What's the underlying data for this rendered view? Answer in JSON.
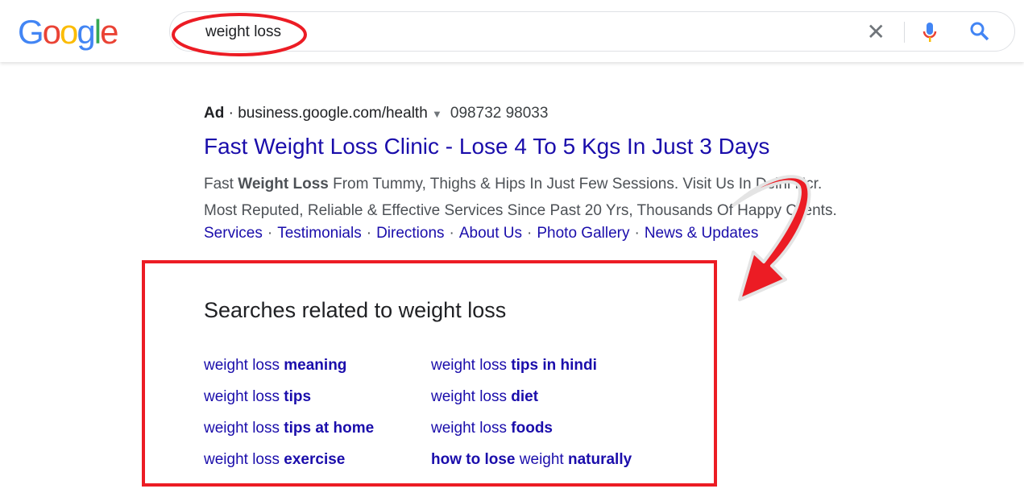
{
  "header": {
    "logo": "Google",
    "query": "weight loss"
  },
  "ad": {
    "label": "Ad",
    "url": "business.google.com/health",
    "phone": "098732 98033",
    "title": "Fast Weight Loss Clinic - Lose 4 To 5 Kgs In Just 3 Days",
    "desc1_pre": "Fast ",
    "desc1_bold": "Weight Loss",
    "desc1_post": " From Tummy, Thighs & Hips In Just Few Sessions. Visit Us In Delhi Ncr.",
    "desc2": "Most Reputed, Reliable & Effective Services Since Past 20 Yrs, Thousands Of Happy Clients.",
    "sitelinks": [
      "Services",
      "Testimonials",
      "Directions",
      "About Us",
      "Photo Gallery",
      "News & Updates"
    ]
  },
  "related": {
    "heading": "Searches related to weight loss",
    "items": [
      {
        "pre": "weight loss ",
        "bold": "meaning",
        "post": ""
      },
      {
        "pre": "weight loss ",
        "bold": "tips",
        "post": ""
      },
      {
        "pre": "weight loss ",
        "bold": "tips at home",
        "post": ""
      },
      {
        "pre": "weight loss ",
        "bold": "exercise",
        "post": ""
      },
      {
        "pre": "weight loss ",
        "bold": "tips in hindi",
        "post": ""
      },
      {
        "pre": "weight loss ",
        "bold": "diet",
        "post": ""
      },
      {
        "pre": "weight loss ",
        "bold": "foods",
        "post": ""
      },
      {
        "pre": "",
        "bold": "how to lose",
        "post": " weight ",
        "bold2": "naturally"
      }
    ]
  },
  "colors": {
    "link": "#1a0dab",
    "annotation": "#ec1c24"
  }
}
